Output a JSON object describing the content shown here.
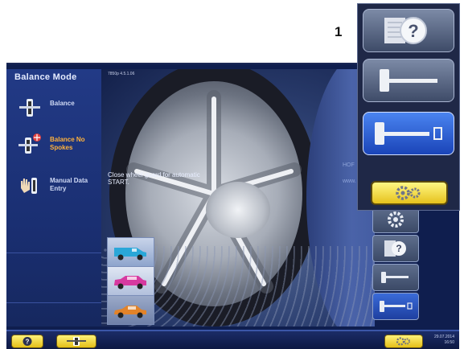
{
  "callout": {
    "number": "1"
  },
  "left_menu": {
    "title": "Balance Mode",
    "items": [
      {
        "label_line1": "Balance",
        "label_line2": "",
        "selected": false,
        "icon": "balance-icon"
      },
      {
        "label_line1": "Balance No",
        "label_line2": "Spokes",
        "selected": true,
        "icon": "balance-no-spokes-icon"
      },
      {
        "label_line1": "Manual Data",
        "label_line2": "Entry",
        "selected": false,
        "icon": "manual-data-entry-icon"
      }
    ]
  },
  "header": {
    "version": "7850p   4.5.1.06"
  },
  "main": {
    "message_line1": "Close wheel guard for automatic",
    "message_line2": "START.",
    "side_text_line1": "HOF",
    "side_text_line2": "www."
  },
  "vehicles": [
    {
      "name": "van",
      "color": "#2aa7d8"
    },
    {
      "name": "suv",
      "color": "#d63aa0"
    },
    {
      "name": "sedan",
      "color": "#e2832a"
    }
  ],
  "right_panel": {
    "buttons": [
      {
        "icon": "gear-icon",
        "selected": false
      },
      {
        "icon": "help-icon",
        "selected": false
      },
      {
        "icon": "weight-clip-icon",
        "selected": false
      },
      {
        "icon": "weight-clip-data-icon",
        "selected": true
      }
    ]
  },
  "overlay": {
    "buttons": [
      {
        "icon": "help-icon",
        "selected": false
      },
      {
        "icon": "weight-clip-icon",
        "selected": false
      },
      {
        "icon": "weight-clip-data-icon",
        "selected": true
      },
      {
        "icon": "gear-icon",
        "selected": false
      }
    ]
  },
  "bottom_bar": {
    "date": "29.07.2014",
    "time": "16:50"
  },
  "colors": {
    "accent": "#ffb23c",
    "button_yellow": "#f2d23a",
    "selected_blue": "#2f5fd0"
  }
}
